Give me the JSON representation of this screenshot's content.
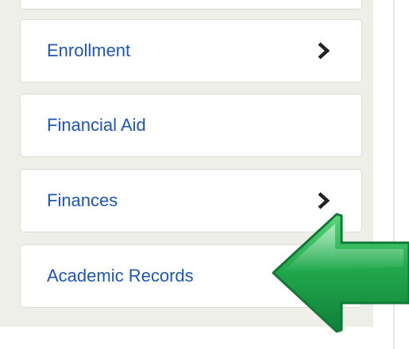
{
  "nav": {
    "items": [
      {
        "label": "Enrollment",
        "has_chevron": true
      },
      {
        "label": "Financial Aid",
        "has_chevron": false
      },
      {
        "label": "Finances",
        "has_chevron": true
      },
      {
        "label": "Academic Records",
        "has_chevron": false
      }
    ]
  },
  "icons": {
    "chevron": "chevron-right-icon",
    "pointer": "arrow-left-icon"
  },
  "colors": {
    "link_text": "#1b56b8",
    "panel_background": "#efefe9",
    "arrow_green": "#1fa54a"
  }
}
